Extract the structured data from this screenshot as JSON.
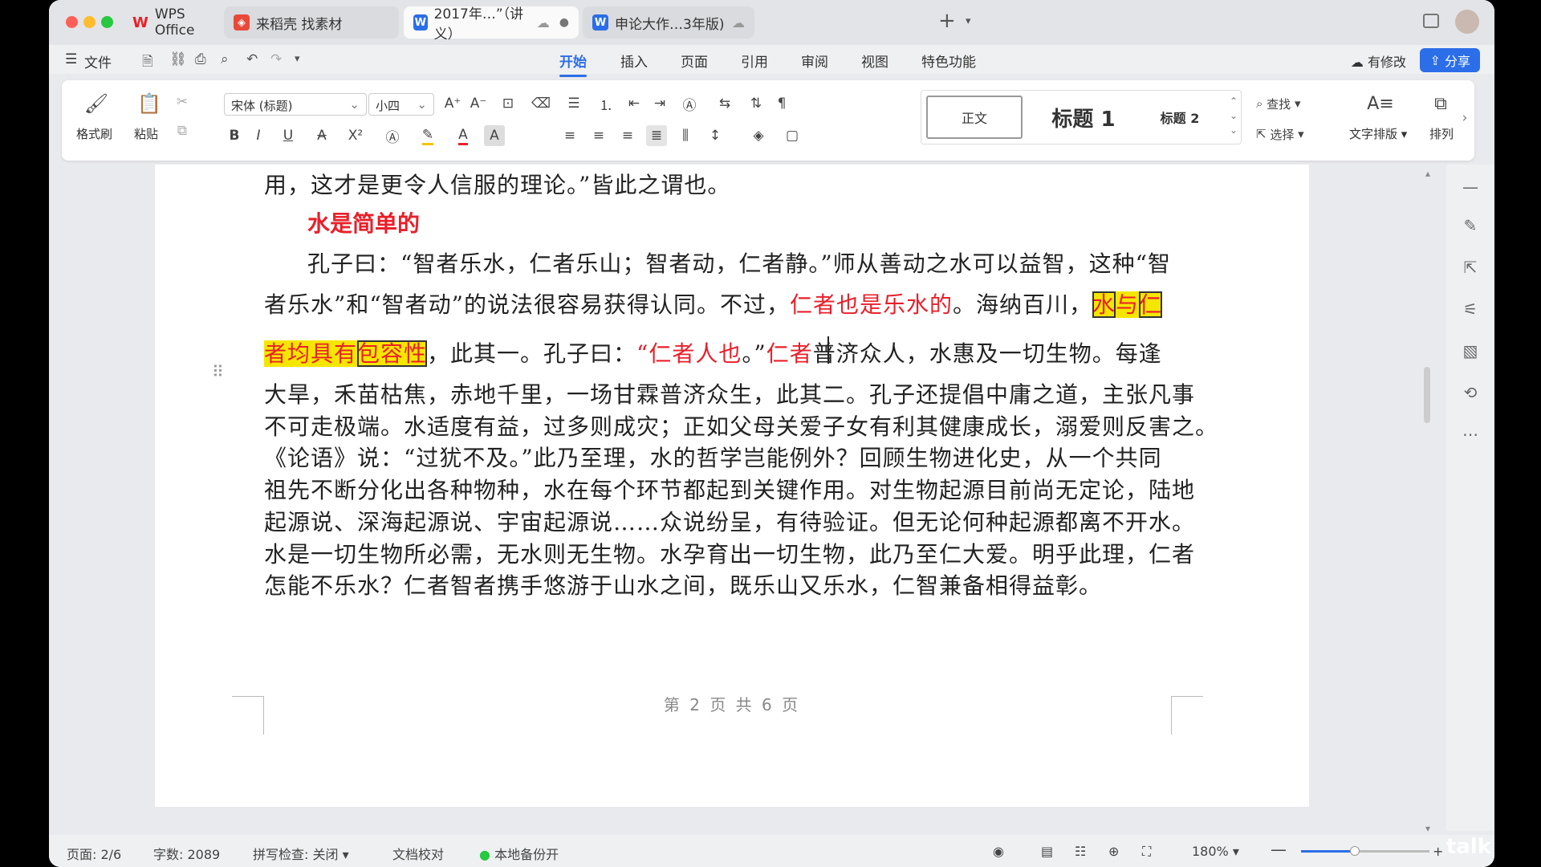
{
  "titlebar": {
    "tabs": [
      {
        "label": "WPS Office",
        "icon": "wps-logo-icon"
      },
      {
        "label": "来稻壳 找素材",
        "icon": "docer-icon"
      },
      {
        "label": "2017年…”（讲义）",
        "icon": "word-doc-icon"
      },
      {
        "label": "申论大作…3年版)",
        "icon": "word-doc-icon"
      }
    ],
    "new_tab": "+"
  },
  "menu": {
    "file": "文件",
    "tabs": [
      "开始",
      "插入",
      "页面",
      "引用",
      "审阅",
      "视图",
      "特色功能"
    ],
    "active_tab": "开始",
    "modify": "有修改",
    "share": "分享"
  },
  "ribbon": {
    "format_painter": "格式刷",
    "paste": "粘贴",
    "font_name": "宋体 (标题)",
    "font_size": "小四",
    "styles": [
      "正文",
      "标题 1",
      "标题 2"
    ],
    "find": "查找",
    "select": "选择",
    "text_layout": "文字排版",
    "arrange": "排列"
  },
  "document": {
    "line0": "用，这才是更令人信服的理论。”皆此之谓也。",
    "heading": "水是简单的",
    "line1": "孔子曰：“智者乐水，仁者乐山；智者动，仁者静。”师从善动之水可以益智，这种“智",
    "line2a": "者乐水”和“智者动”的说法很容易获得认同。不过，",
    "line2b": "仁者也是乐水的",
    "line2c": "。海纳百川，",
    "line2d": "水",
    "line2e": "与",
    "line2f": "仁",
    "line3a": "者均具有",
    "line3b": "包容性",
    "line3c": "，此其一。孔子曰：",
    "line3d": "“仁者人也",
    "line3e": "。”",
    "line3f": "仁者",
    "line3g": "普济众人，水惠及一切生物。每逢",
    "lines": [
      "大旱，禾苗枯焦，赤地千里，一场甘霖普济众生，此其二。孔子还提倡中庸之道，主张凡事",
      "不可走极端。水适度有益，过多则成灾；正如父母关爱子女有利其健康成长，溺爱则反害之。",
      "《论语》说：“过犹不及。”此乃至理，水的哲学岂能例外？回顾生物进化史，从一个共同",
      "祖先不断分化出各种物种，水在每个环节都起到关键作用。对生物起源目前尚无定论，陆地",
      "起源说、深海起源说、宇宙起源说……众说纷呈，有待验证。但无论何种起源都离不开水。",
      "水是一切生物所必需，无水则无生物。水孕育出一切生物，此乃至仁大爱。明乎此理，仁者",
      "怎能不乐水？仁者智者携手悠游于山水之间，既乐山又乐水，仁智兼备相得益彰。"
    ],
    "page_footer": "第 2 页 共 6 页"
  },
  "statusbar": {
    "page": "页面: 2/6",
    "words": "字数: 2089",
    "spell": "拼写检查: 关闭",
    "proofread": "文档校对",
    "backup": "本地备份开",
    "zoom": "180%",
    "zoom_fraction": 0.42
  },
  "watermark": "talk",
  "colors": {
    "accent": "#2b6ee8",
    "red_text": "#e8202a",
    "highlight": "#f5e600"
  }
}
